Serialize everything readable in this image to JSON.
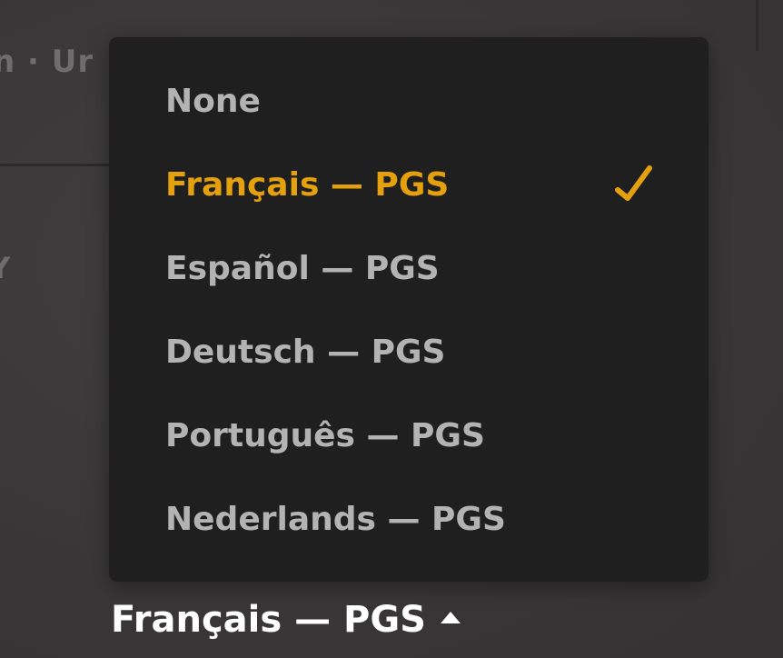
{
  "background": {
    "header_text": "n · Ur",
    "fragment_letter": "Y"
  },
  "menu": {
    "items": [
      {
        "label": "None",
        "selected": false
      },
      {
        "label": "Français — PGS",
        "selected": true
      },
      {
        "label": "Español — PGS",
        "selected": false
      },
      {
        "label": "Deutsch — PGS",
        "selected": false
      },
      {
        "label": "Português — PGS",
        "selected": false
      },
      {
        "label": "Nederlands — PGS",
        "selected": false
      }
    ],
    "check_icon": "checkmark-icon"
  },
  "selector": {
    "current_label": "Français — PGS",
    "caret_icon": "caret-up-icon"
  },
  "colors": {
    "accent": "#e5a00d",
    "menu_bg": "#1f1f20",
    "text": "#b3b3b3"
  }
}
